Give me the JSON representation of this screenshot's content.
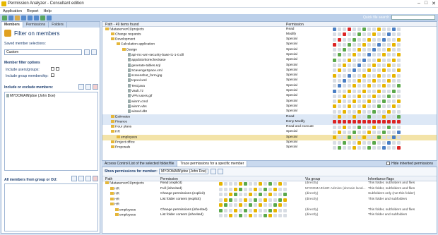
{
  "app": {
    "title": "Permission Analyzer - Consultant edition"
  },
  "menu": [
    "Application",
    "Report",
    "Help"
  ],
  "quick_search": {
    "label": "Quick file search",
    "value": ""
  },
  "left": {
    "tabs": [
      "Members",
      "Permissions",
      "Folders"
    ],
    "title": "Filter on members",
    "saved_label": "Saved member selections:",
    "selection": "Custom",
    "member_filter_heading": "Member filter options",
    "include_users_label": "Include users/groups:",
    "include_members_label": "Include group membership:",
    "include_exclude_heading": "Include or exclude members:",
    "member": "MYDOMAIN\\jdoe (John Doe)",
    "all_members_heading": "All members from group or OU:"
  },
  "tree": {
    "path_header": "Path - 49 items found",
    "permission_header": "Permission",
    "rows": [
      {
        "name": "\\\\dataserver01\\projects",
        "perm": "Read",
        "indent": 0,
        "icon": "folder"
      },
      {
        "name": "Change requests",
        "perm": "Modify",
        "indent": 1,
        "icon": "folder"
      },
      {
        "name": "Development",
        "perm": "Special",
        "indent": 1,
        "icon": "folder"
      },
      {
        "name": "Calculation application",
        "perm": "Special",
        "indent": 2,
        "icon": "folder"
      },
      {
        "name": "Design",
        "perm": "Special",
        "indent": 3,
        "icon": "folder"
      },
      {
        "name": "api-rnc-wm-security-base-i1-1-0.dll",
        "perm": "Special",
        "indent": 4,
        "icon": "file"
      },
      {
        "name": "appdotoritorecheckase",
        "perm": "Special",
        "indent": 4,
        "icon": "file"
      },
      {
        "name": "generate-tables.sql",
        "perm": "Special",
        "indent": 4,
        "icon": "file"
      },
      {
        "name": "ScavengeSpace.xml",
        "perm": "Special",
        "indent": 4,
        "icon": "file"
      },
      {
        "name": "screenshot_form.jpg",
        "perm": "Special",
        "indent": 4,
        "icon": "file"
      },
      {
        "name": "tcpool.xml",
        "perm": "Special",
        "indent": 4,
        "icon": "file"
      },
      {
        "name": "Test.java",
        "perm": "Special",
        "indent": 4,
        "icon": "file"
      },
      {
        "name": "Vault.7z",
        "perm": "Special",
        "indent": 4,
        "icon": "file"
      },
      {
        "name": "VPN users.gif",
        "perm": "Special",
        "indent": 4,
        "icon": "file"
      },
      {
        "name": "winrm.cmd",
        "perm": "Special",
        "indent": 4,
        "icon": "file"
      },
      {
        "name": "winrm.vbs",
        "perm": "Special",
        "indent": 4,
        "icon": "file"
      },
      {
        "name": "wizard.dbt",
        "perm": "Special",
        "indent": 4,
        "icon": "file"
      },
      {
        "name": "Estimates",
        "perm": "Read",
        "indent": 1,
        "icon": "folder"
      },
      {
        "name": "Finance",
        "perm": "Deny Modify",
        "indent": 1,
        "icon": "folder"
      },
      {
        "name": "Hour plans",
        "perm": "Read and execute",
        "indent": 1,
        "icon": "folder"
      },
      {
        "name": "HR",
        "perm": "Special",
        "indent": 1,
        "icon": "folder"
      },
      {
        "name": "employees",
        "perm": "Special",
        "indent": 2,
        "icon": "folder"
      },
      {
        "name": "Project office",
        "perm": "Special",
        "indent": 1,
        "icon": "folder"
      },
      {
        "name": "Proposals",
        "perm": "Special",
        "indent": 1,
        "icon": "folder"
      }
    ]
  },
  "bottom": {
    "tabs": [
      "Access Control List of the selected folder/file",
      "Trace permissions for a specific member"
    ],
    "hide_inherited": "Hide inherited permissions",
    "show_for_label": "Show permissions for member:",
    "member": "MYDOMAIN\\jdoe (John Doe)",
    "headers": {
      "path": "Path",
      "permission": "Permission",
      "via": "Via group",
      "flags": "Inheritance flags"
    },
    "rows": [
      {
        "path": "\\\\dataserver01\\projects",
        "perm": "Read (explicit)",
        "via": "(directly)",
        "flags": "This folder, subfolders and files",
        "indent": 0
      },
      {
        "path": "HR",
        "perm": "Full (inherited)",
        "via": "MYDOMAIN\\HR Admins (domain local...",
        "flags": "This folder, subfolders and files",
        "indent": 1
      },
      {
        "path": "HR",
        "perm": "Change permissions (explicit)",
        "via": "(directly)",
        "flags": "Subfolders only (not this folder)",
        "indent": 1
      },
      {
        "path": "HR",
        "perm": "List folder content (explicit)",
        "via": "(directly)",
        "flags": "This folder and subfolders",
        "indent": 1
      },
      {
        "path": "HR",
        "perm": "",
        "via": "",
        "flags": "",
        "indent": 1
      },
      {
        "path": "employees",
        "perm": "Change permissions (inherited)",
        "via": "(directly)",
        "flags": "This folder, subfolders and files",
        "indent": 2
      },
      {
        "path": "employees",
        "perm": "List folder content (inherited)",
        "via": "(directly)",
        "flags": "This folder and subfolders",
        "indent": 2
      }
    ]
  }
}
